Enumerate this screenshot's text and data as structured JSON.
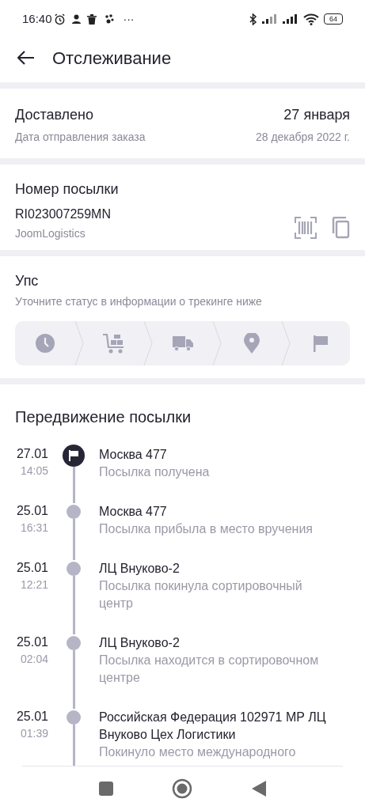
{
  "status_bar": {
    "time": "16:40",
    "more": "···",
    "battery": "64"
  },
  "header": {
    "title": "Отслеживание"
  },
  "delivery": {
    "status": "Доставлено",
    "date": "27 января",
    "caption": "Дата отправления заказа",
    "sent_date": "28 декабря 2022 г."
  },
  "parcel": {
    "label": "Номер посылки",
    "number": "RI023007259MN",
    "carrier": "JoomLogistics"
  },
  "notice": {
    "title": "Упс",
    "text": "Уточните статус в информации о трекинге ниже"
  },
  "movement": {
    "title": "Передвижение посылки",
    "events": [
      {
        "date": "27.01",
        "time": "14:05",
        "place": "Москва 477",
        "status": "Посылка получена",
        "current": true
      },
      {
        "date": "25.01",
        "time": "16:31",
        "place": "Москва 477",
        "status": "Посылка прибыла в место вручения",
        "current": false
      },
      {
        "date": "25.01",
        "time": "12:21",
        "place": "ЛЦ Внуково-2",
        "status": "Посылка покинула сортировочный центр",
        "current": false
      },
      {
        "date": "25.01",
        "time": "02:04",
        "place": "ЛЦ Внуково-2",
        "status": "Посылка находится в сортировочном центре",
        "current": false
      },
      {
        "date": "25.01",
        "time": "01:39",
        "place": "Российская Федерация 102971 МР ЛЦ Внуково Цех Логистики",
        "status": "Покинуло место международного",
        "current": false
      }
    ]
  }
}
